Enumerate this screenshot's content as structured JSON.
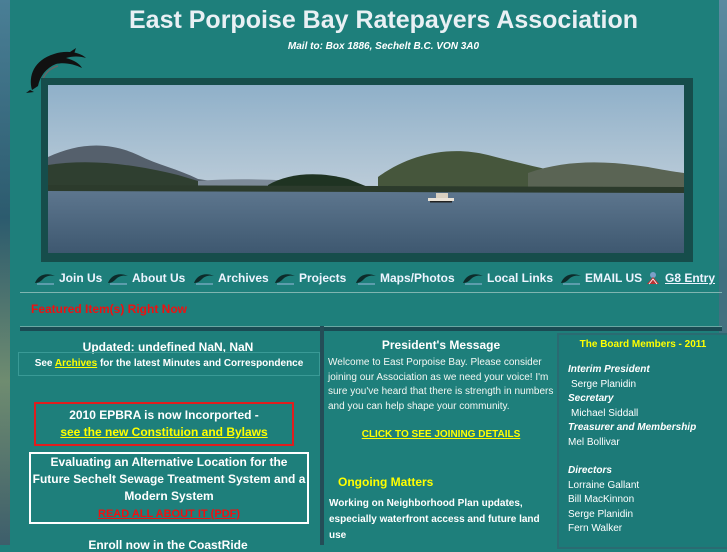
{
  "header": {
    "title": "East Porpoise Bay Ratepayers Association",
    "mailing": "Mail to: Box 1886,  Sechelt B.C. VON 3A0"
  },
  "nav": [
    {
      "label": "Join Us"
    },
    {
      "label": "About Us"
    },
    {
      "label": "Archives"
    },
    {
      "label": "Projects"
    },
    {
      "label": "Maps/Photos"
    },
    {
      "label": "Local Links"
    },
    {
      "label": "EMAIL US"
    },
    {
      "label": "G8 Entry"
    }
  ],
  "featured": "Featured Item(s) Right Now",
  "left": {
    "updated": "Updated: undefined NaN, NaN",
    "see_prefix": "See",
    "archives_link": "Archives",
    "see_suffix": "for the latest Minutes and Correspondence",
    "incorp_line": "2010 EPBRA is now Incorported -",
    "incorp_link": "see the new Constituion and Bylaws",
    "eval_text": "Evaluating an Alternative Location for the Future Sechelt Sewage Treatment System and a Modern System",
    "eval_link": "READ ALL ABOUT IT (PDF)",
    "enroll": "Enroll now in the CoastRide"
  },
  "president": {
    "title": "President's Message",
    "text": "Welcome to East Porpoise Bay.  Please consider joining our Association as we need your voice!  I'm sure you've heard that there is strength in numbers and you can help shape your community.",
    "join_link": "CLICK TO SEE JOINING DETAILS",
    "ongoing_title": "Ongoing Matters",
    "ongoing_text": "Working on Neighborhood Plan updates, especially waterfront access and future land use"
  },
  "board": {
    "title": "The Board Members - 2011",
    "roles": {
      "interim_president": "Interim President",
      "secretary": "Secretary",
      "treasurer": "Treasurer and Membership",
      "directors": "Directors"
    },
    "names": {
      "president": "Serge Planidin",
      "secretary": "Michael Siddall",
      "treasurer": "Mel Bollivar",
      "directors": [
        "Lorraine Gallant",
        "Bill MacKinnon",
        "Serge Planidin",
        "Fern Walker"
      ]
    }
  },
  "colors": {
    "background": "#1e7f7b",
    "link": "#ffff00",
    "alert": "#e11111"
  }
}
